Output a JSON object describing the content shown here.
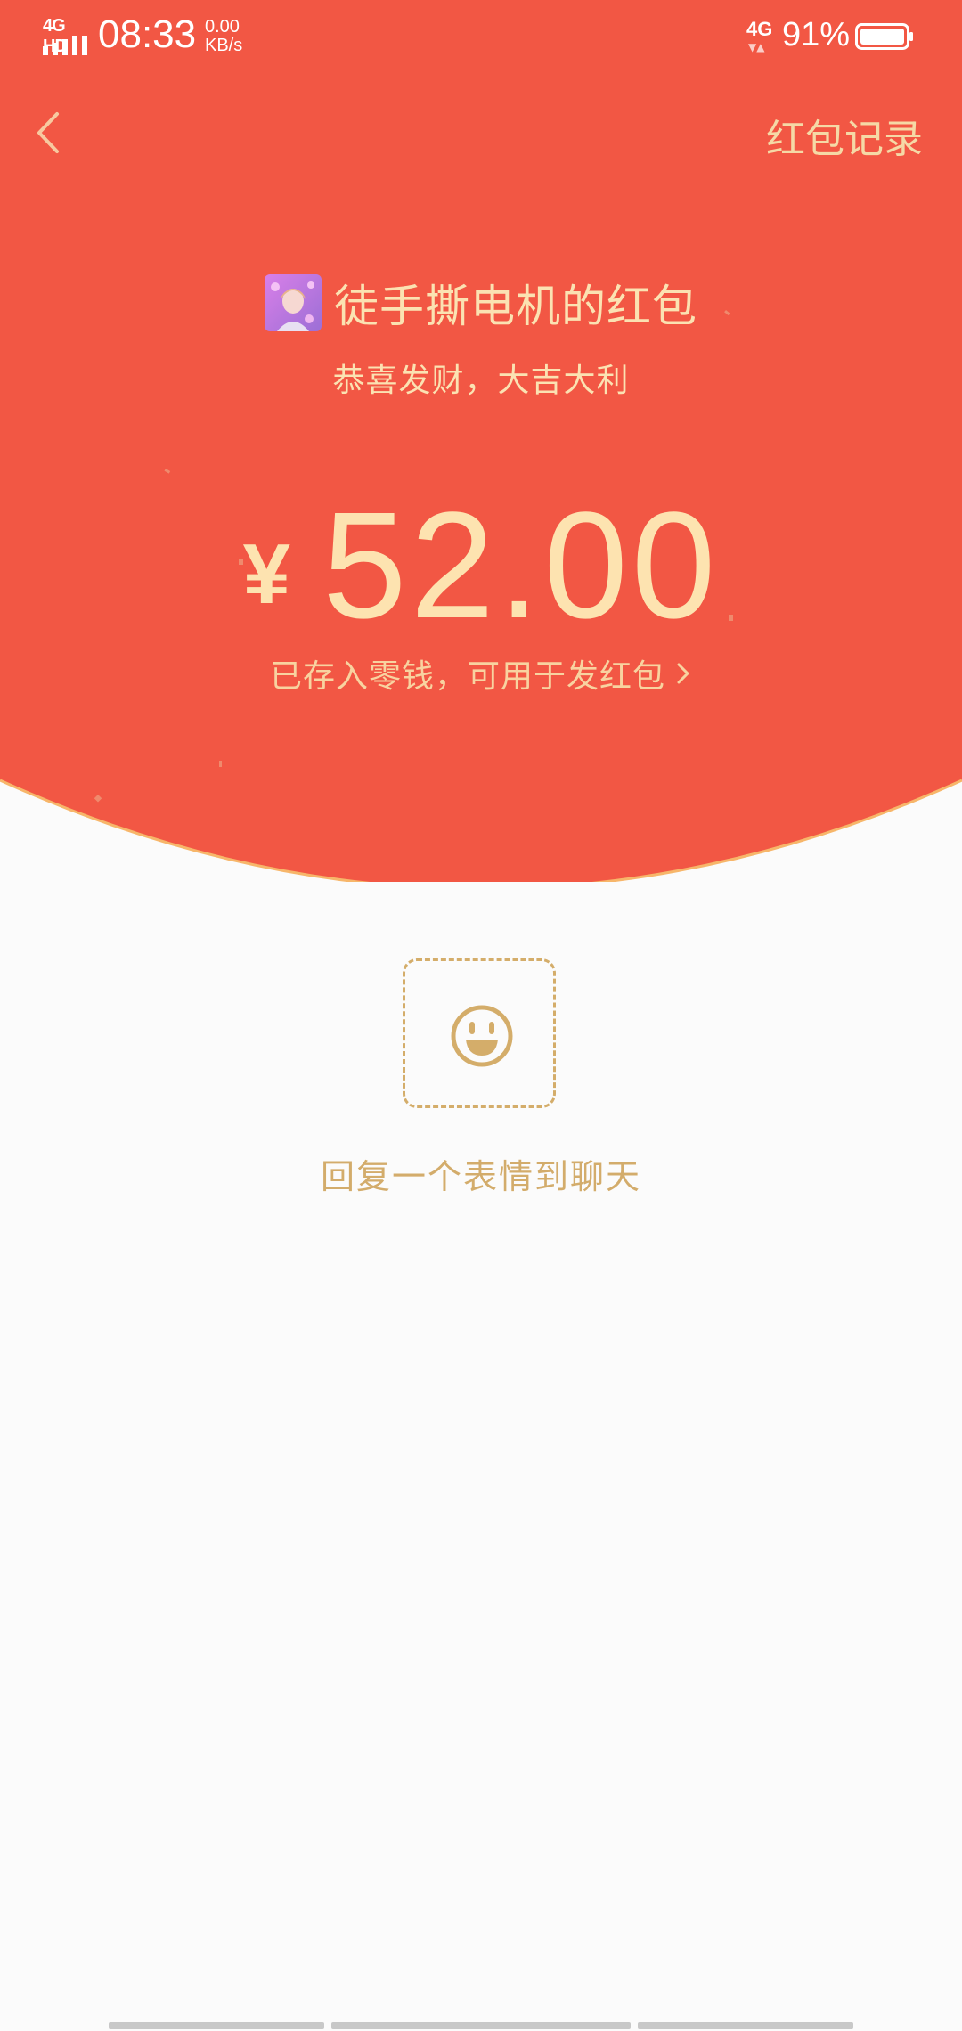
{
  "status_bar": {
    "network_label": "4G HD",
    "time": "08:33",
    "speed_value": "0.00",
    "speed_unit": "KB/s",
    "mobile_data": "4G",
    "battery_percent": "91%"
  },
  "nav": {
    "back_icon": "chevron-left-icon",
    "records_label": "红包记录"
  },
  "packet": {
    "sender_title": "徒手撕电机的红包",
    "wish": "恭喜发财，大吉大利",
    "currency": "¥",
    "amount": "52.00",
    "saved_note": "已存入零钱，可用于发红包",
    "saved_note_icon": "chevron-right-icon"
  },
  "reply": {
    "emoji_icon": "smiley-icon",
    "label": "回复一个表情到聊天"
  },
  "colors": {
    "header_red": "#f25744",
    "gold_text": "#fbe2b2",
    "emoji_gold": "#d4ad6a",
    "background": "#fbfbfb"
  }
}
